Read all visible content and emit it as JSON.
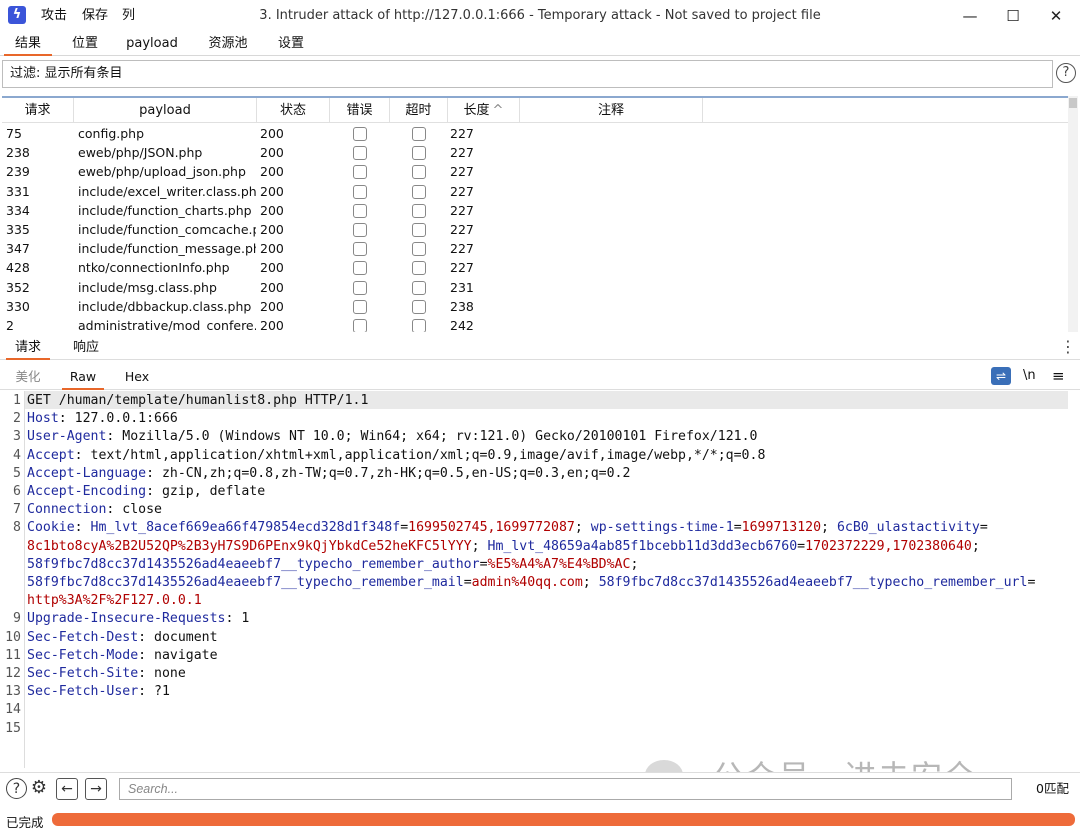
{
  "titlebar": {
    "menu": [
      "攻击",
      "保存",
      "列"
    ],
    "title": "3. Intruder attack of http://127.0.0.1:666 - Temporary attack - Not saved to project file"
  },
  "main_tabs": [
    "结果",
    "位置",
    "payload",
    "资源池",
    "设置"
  ],
  "filter": {
    "label": "过滤: 显示所有条目",
    "help": "?"
  },
  "results_table": {
    "columns": [
      "请求",
      "payload",
      "状态",
      "错误",
      "超时",
      "长度",
      "注释"
    ],
    "sort_indicator": "^",
    "rows": [
      {
        "req": "75",
        "payload": "config.php",
        "status": "200",
        "error": false,
        "timeout": false,
        "length": "227"
      },
      {
        "req": "238",
        "payload": "eweb/php/JSON.php",
        "status": "200",
        "error": false,
        "timeout": false,
        "length": "227"
      },
      {
        "req": "239",
        "payload": "eweb/php/upload_json.php",
        "status": "200",
        "error": false,
        "timeout": false,
        "length": "227"
      },
      {
        "req": "331",
        "payload": "include/excel_writer.class.php",
        "status": "200",
        "error": false,
        "timeout": false,
        "length": "227"
      },
      {
        "req": "334",
        "payload": "include/function_charts.php",
        "status": "200",
        "error": false,
        "timeout": false,
        "length": "227"
      },
      {
        "req": "335",
        "payload": "include/function_comcache.p...",
        "status": "200",
        "error": false,
        "timeout": false,
        "length": "227"
      },
      {
        "req": "347",
        "payload": "include/function_message.ph...",
        "status": "200",
        "error": false,
        "timeout": false,
        "length": "227"
      },
      {
        "req": "428",
        "payload": "ntko/connectionInfo.php",
        "status": "200",
        "error": false,
        "timeout": false,
        "length": "227"
      },
      {
        "req": "352",
        "payload": "include/msg.class.php",
        "status": "200",
        "error": false,
        "timeout": false,
        "length": "231"
      },
      {
        "req": "330",
        "payload": "include/dbbackup.class.php",
        "status": "200",
        "error": false,
        "timeout": false,
        "length": "238"
      },
      {
        "req": "2",
        "payload": "administrative/mod_confere...",
        "status": "200",
        "error": false,
        "timeout": false,
        "length": "242"
      }
    ]
  },
  "detail_tabs": [
    "请求",
    "响应"
  ],
  "view_tabs": [
    "美化",
    "Raw",
    "Hex"
  ],
  "editor_tools": {
    "wrap_icon": "wrap-lines-icon",
    "newline": "\\n",
    "menu": "≡"
  },
  "editor": {
    "lines": [
      {
        "n": "1",
        "parts": [
          {
            "t": "GET /human/template/humanlist8.php HTTP/1.1",
            "c": ""
          }
        ]
      },
      {
        "n": "2",
        "parts": [
          {
            "t": "Host",
            "c": "k"
          },
          {
            "t": ": 127.0.0.1:666",
            "c": ""
          }
        ]
      },
      {
        "n": "3",
        "parts": [
          {
            "t": "User-Agent",
            "c": "k"
          },
          {
            "t": ": Mozilla/5.0 (Windows NT 10.0; Win64; x64; rv:121.0) Gecko/20100101 Firefox/121.0",
            "c": ""
          }
        ]
      },
      {
        "n": "4",
        "parts": [
          {
            "t": "Accept",
            "c": "k"
          },
          {
            "t": ": text/html,application/xhtml+xml,application/xml;q=0.9,image/avif,image/webp,*/*;q=0.8",
            "c": ""
          }
        ]
      },
      {
        "n": "5",
        "parts": [
          {
            "t": "Accept-Language",
            "c": "k"
          },
          {
            "t": ": zh-CN,zh;q=0.8,zh-TW;q=0.7,zh-HK;q=0.5,en-US;q=0.3,en;q=0.2",
            "c": ""
          }
        ]
      },
      {
        "n": "6",
        "parts": [
          {
            "t": "Accept-Encoding",
            "c": "k"
          },
          {
            "t": ": gzip, deflate",
            "c": ""
          }
        ]
      },
      {
        "n": "7",
        "parts": [
          {
            "t": "Connection",
            "c": "k"
          },
          {
            "t": ": close",
            "c": ""
          }
        ]
      },
      {
        "n": "8",
        "parts": [
          {
            "t": "Cookie",
            "c": "k"
          },
          {
            "t": ": ",
            "c": ""
          },
          {
            "t": "Hm_lvt_8acef669ea66f479854ecd328d1f348f",
            "c": "k"
          },
          {
            "t": "=",
            "c": ""
          },
          {
            "t": "1699502745,1699772087",
            "c": "r"
          },
          {
            "t": "; ",
            "c": ""
          },
          {
            "t": "wp-settings-time-1",
            "c": "k"
          },
          {
            "t": "=",
            "c": ""
          },
          {
            "t": "1699713120",
            "c": "r"
          },
          {
            "t": "; ",
            "c": ""
          },
          {
            "t": "6cB0_ulastactivity",
            "c": "k"
          },
          {
            "t": "=",
            "c": ""
          }
        ]
      },
      {
        "n": "",
        "parts": [
          {
            "t": "8c1bto8cyA%2B2U52QP%2B3yH7S9D6PEnx9kQjYbkdCe52heKFC5lYYY",
            "c": "r"
          },
          {
            "t": "; ",
            "c": ""
          },
          {
            "t": "Hm_lvt_48659a4ab85f1bcebb11d3dd3ecb6760",
            "c": "k"
          },
          {
            "t": "=",
            "c": ""
          },
          {
            "t": "1702372229,1702380640",
            "c": "r"
          },
          {
            "t": ";",
            "c": ""
          }
        ]
      },
      {
        "n": "",
        "parts": [
          {
            "t": "58f9fbc7d8cc37d1435526ad4eaeebf7__typecho_remember_author",
            "c": "k"
          },
          {
            "t": "=",
            "c": ""
          },
          {
            "t": "%E5%A4%A7%E4%BD%AC",
            "c": "r"
          },
          {
            "t": ";",
            "c": ""
          }
        ]
      },
      {
        "n": "",
        "parts": [
          {
            "t": "58f9fbc7d8cc37d1435526ad4eaeebf7__typecho_remember_mail",
            "c": "k"
          },
          {
            "t": "=",
            "c": ""
          },
          {
            "t": "admin%40qq.com",
            "c": "r"
          },
          {
            "t": "; ",
            "c": ""
          },
          {
            "t": "58f9fbc7d8cc37d1435526ad4eaeebf7__typecho_remember_url",
            "c": "k"
          },
          {
            "t": "=",
            "c": ""
          }
        ]
      },
      {
        "n": "",
        "parts": [
          {
            "t": "http%3A%2F%2F127.0.0.1",
            "c": "r"
          }
        ]
      },
      {
        "n": "9",
        "parts": [
          {
            "t": "Upgrade-Insecure-Requests",
            "c": "k"
          },
          {
            "t": ": 1",
            "c": ""
          }
        ]
      },
      {
        "n": "10",
        "parts": [
          {
            "t": "Sec-Fetch-Dest",
            "c": "k"
          },
          {
            "t": ": document",
            "c": ""
          }
        ]
      },
      {
        "n": "11",
        "parts": [
          {
            "t": "Sec-Fetch-Mode",
            "c": "k"
          },
          {
            "t": ": navigate",
            "c": ""
          }
        ]
      },
      {
        "n": "12",
        "parts": [
          {
            "t": "Sec-Fetch-Site",
            "c": "k"
          },
          {
            "t": ": none",
            "c": ""
          }
        ]
      },
      {
        "n": "13",
        "parts": [
          {
            "t": "Sec-Fetch-User",
            "c": "k"
          },
          {
            "t": ": ?1",
            "c": ""
          }
        ]
      },
      {
        "n": "14",
        "parts": []
      },
      {
        "n": "15",
        "parts": []
      }
    ]
  },
  "bottom": {
    "search_placeholder": "Search...",
    "matches": "0匹配"
  },
  "watermark": "公众号 · 进击安全",
  "status": {
    "text": "已完成",
    "progress": 1.0,
    "progress_color": "#ee6b3a"
  }
}
